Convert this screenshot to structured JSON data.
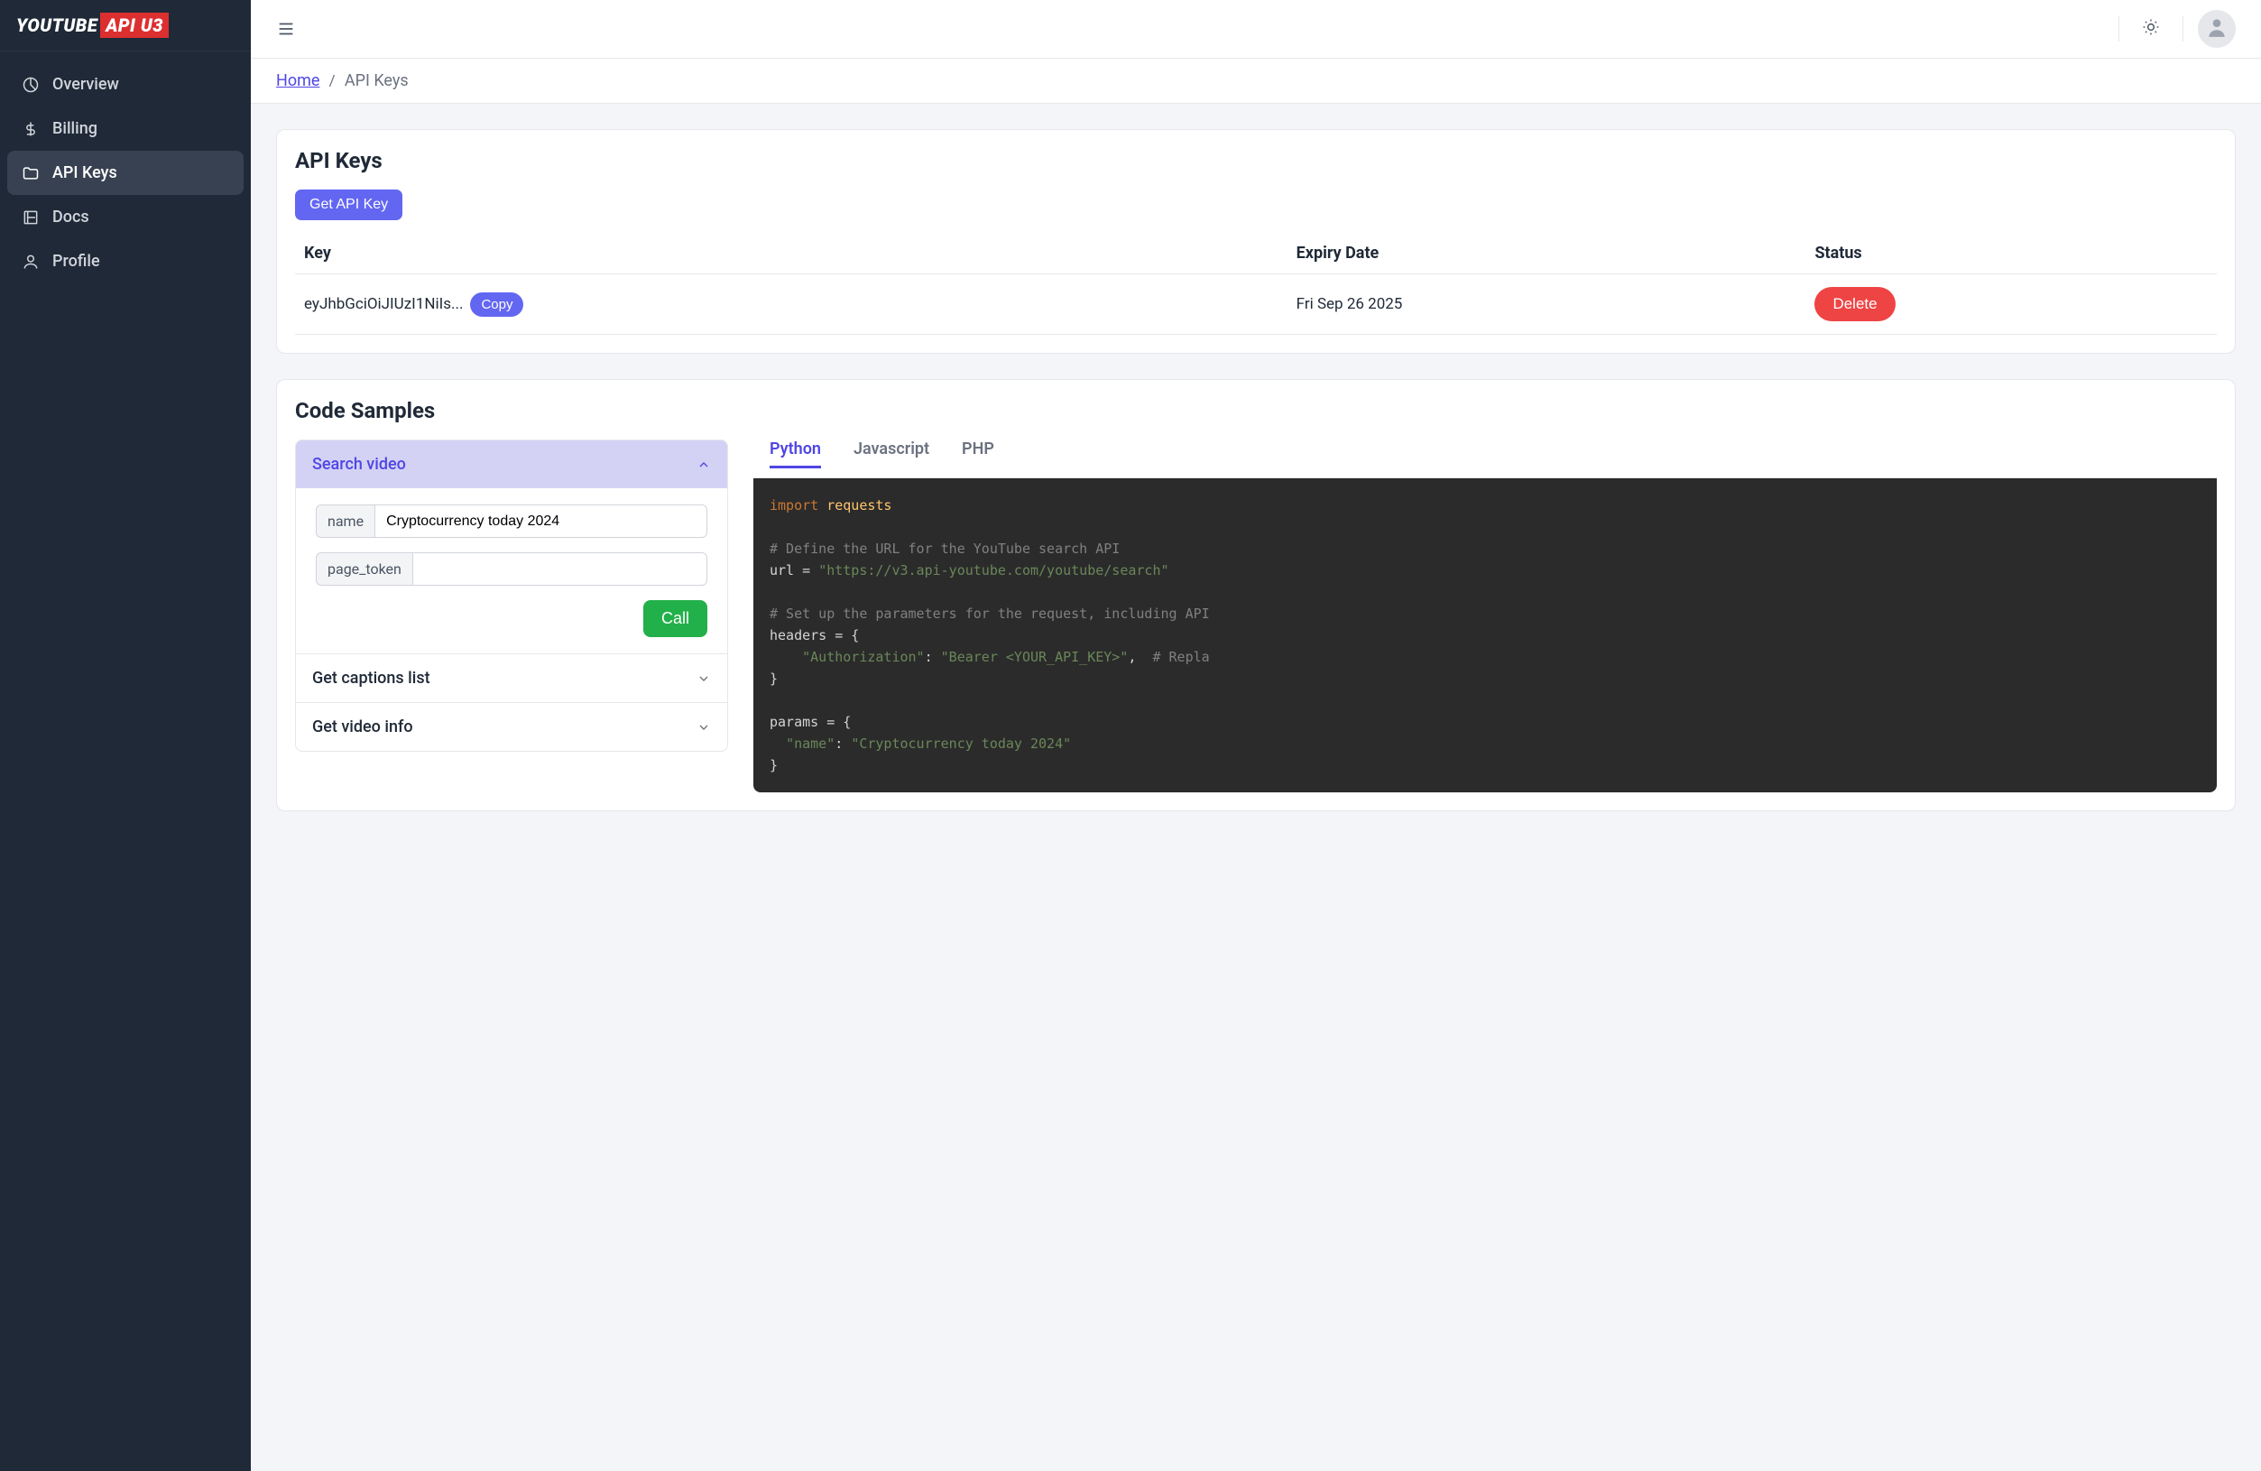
{
  "logo": {
    "part1": "YOUTUBE",
    "part2": "API U3"
  },
  "sidebar": {
    "items": [
      {
        "label": "Overview"
      },
      {
        "label": "Billing"
      },
      {
        "label": "API Keys"
      },
      {
        "label": "Docs"
      },
      {
        "label": "Profile"
      }
    ]
  },
  "breadcrumb": {
    "home": "Home",
    "sep": "/",
    "current": "API Keys"
  },
  "api_keys": {
    "title": "API Keys",
    "get_btn": "Get API Key",
    "columns": {
      "key": "Key",
      "expiry": "Expiry Date",
      "status": "Status"
    },
    "rows": [
      {
        "key": "eyJhbGciOiJIUzI1NiIs...",
        "copy": "Copy",
        "expiry": "Fri Sep 26 2025",
        "delete": "Delete"
      }
    ]
  },
  "samples": {
    "title": "Code Samples",
    "accordion": [
      {
        "label": "Search video",
        "expanded": true,
        "fields": [
          {
            "name": "name",
            "value": "Cryptocurrency today 2024"
          },
          {
            "name": "page_token",
            "value": ""
          }
        ],
        "call": "Call"
      },
      {
        "label": "Get captions list",
        "expanded": false
      },
      {
        "label": "Get video info",
        "expanded": false
      }
    ],
    "tabs": [
      "Python",
      "Javascript",
      "PHP"
    ],
    "code": {
      "l1_kw": "import",
      "l1_mod": " requests",
      "l2_cmt": "# Define the URL for the YouTube search API",
      "l3a": "url = ",
      "l3b": "\"https://v3.api-youtube.com/youtube/search\"",
      "l4_cmt": "# Set up the parameters for the request, including API",
      "l5": "headers = {",
      "l6a": "    ",
      "l6b": "\"Authorization\"",
      "l6c": ": ",
      "l6d": "\"Bearer <YOUR_API_KEY>\"",
      "l6e": ",  ",
      "l6f": "# Repla",
      "l7": "}",
      "l8": "params = {",
      "l9a": "  ",
      "l9b": "\"name\"",
      "l9c": ": ",
      "l9d": "\"Cryptocurrency today 2024\"",
      "l10": "}"
    }
  }
}
